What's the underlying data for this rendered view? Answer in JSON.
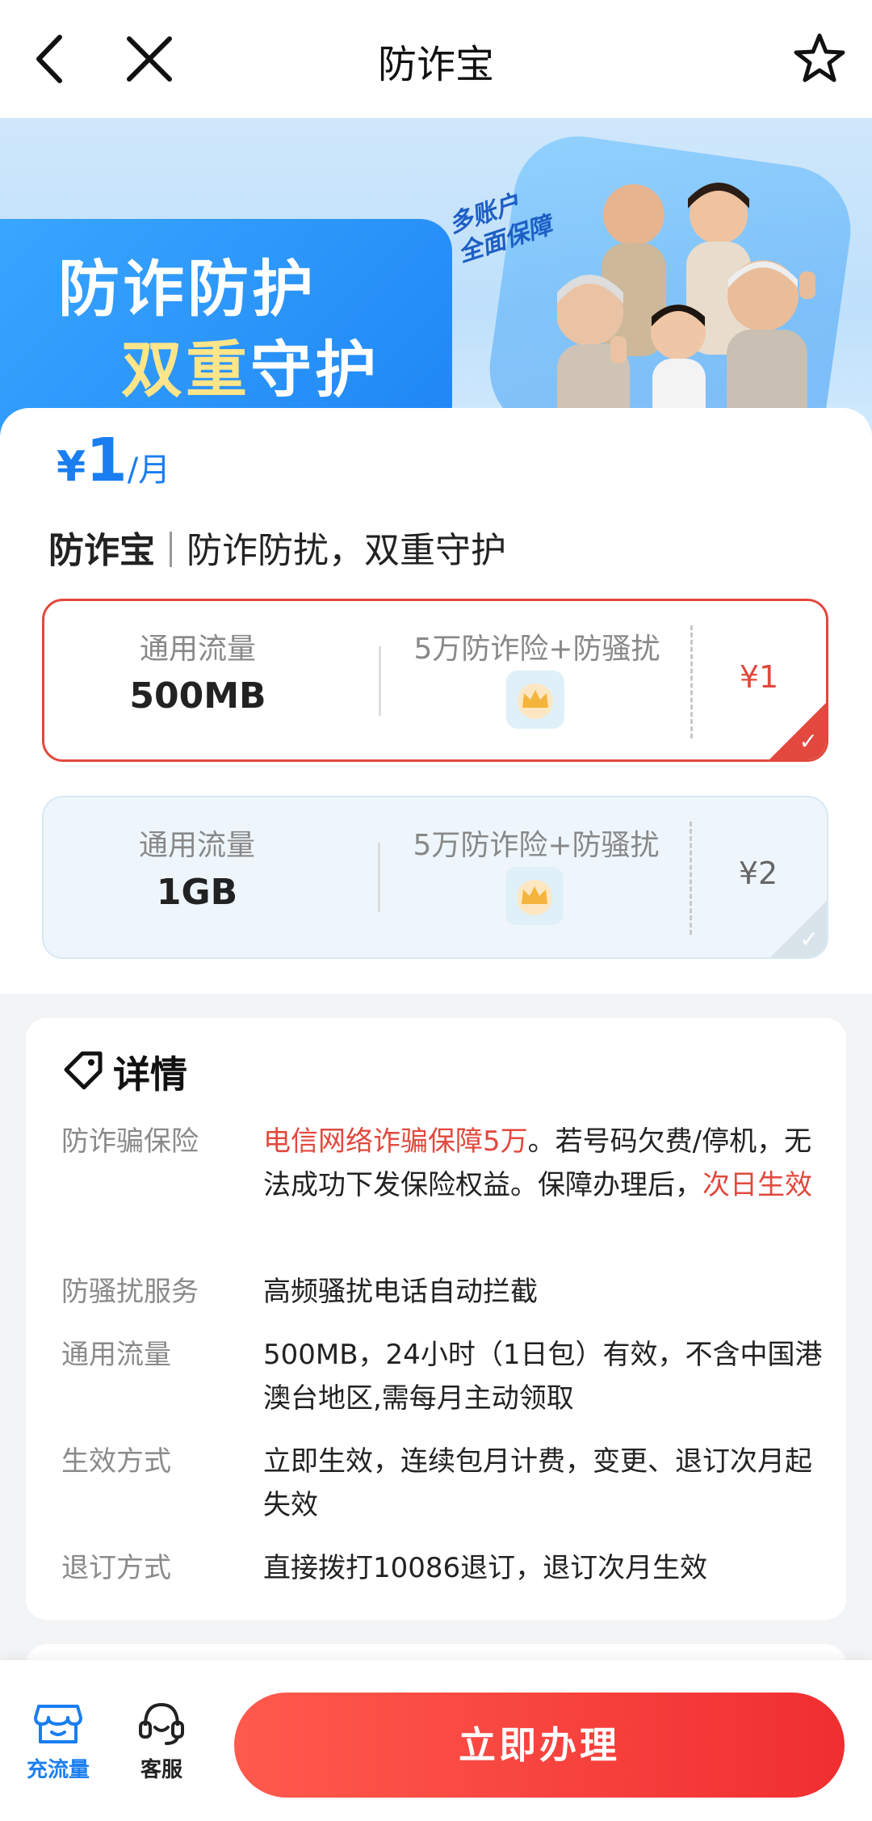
{
  "header": {
    "title": "防诈宝",
    "back_icon": "back-arrow-icon",
    "close_icon": "close-icon",
    "favorite_icon": "star-icon"
  },
  "banner": {
    "slogan_line1": "防诈防护",
    "slogan_line2_highlight": "双重",
    "slogan_line2_rest": "守护",
    "handwritten_line1": "多账户",
    "handwritten_line2": "全面保障"
  },
  "product": {
    "price_currency": "¥",
    "price_value": "1",
    "price_unit": "/月",
    "name": "防诈宝",
    "tagline": "防诈防扰，双重守护",
    "options": [
      {
        "data_label": "通用流量",
        "data_value": "500MB",
        "service_label": "5万防诈险+防骚扰",
        "price": "¥1",
        "selected": true
      },
      {
        "data_label": "通用流量",
        "data_value": "1GB",
        "service_label": "5万防诈险+防骚扰",
        "price": "¥2",
        "selected": false
      }
    ]
  },
  "details": {
    "title": "详情",
    "rows": [
      {
        "key": "防诈骗保险",
        "value_red1": "电信网络诈骗保障5万",
        "value_mid": "。若号码欠费/停机，无法成功下发保险权益。保障办理后，",
        "value_red2": "次日生效"
      },
      {
        "key": "防骚扰服务",
        "value": "高频骚扰电话自动拦截"
      },
      {
        "key": "通用流量",
        "value": "500MB，24小时（1日包）有效，不含中国港澳台地区,需每月主动领取"
      },
      {
        "key": "生效方式",
        "value": "立即生效，连续包月计费，变更、退订次月起失效"
      },
      {
        "key": "退订方式",
        "value": "直接拨打10086退订，退订次月生效"
      }
    ]
  },
  "bottom_bar": {
    "tab1_label": "充流量",
    "tab2_label": "客服",
    "cta_label": "立即办理",
    "accent_color": "#1a7ef0",
    "cta_color": "#f0392f"
  }
}
